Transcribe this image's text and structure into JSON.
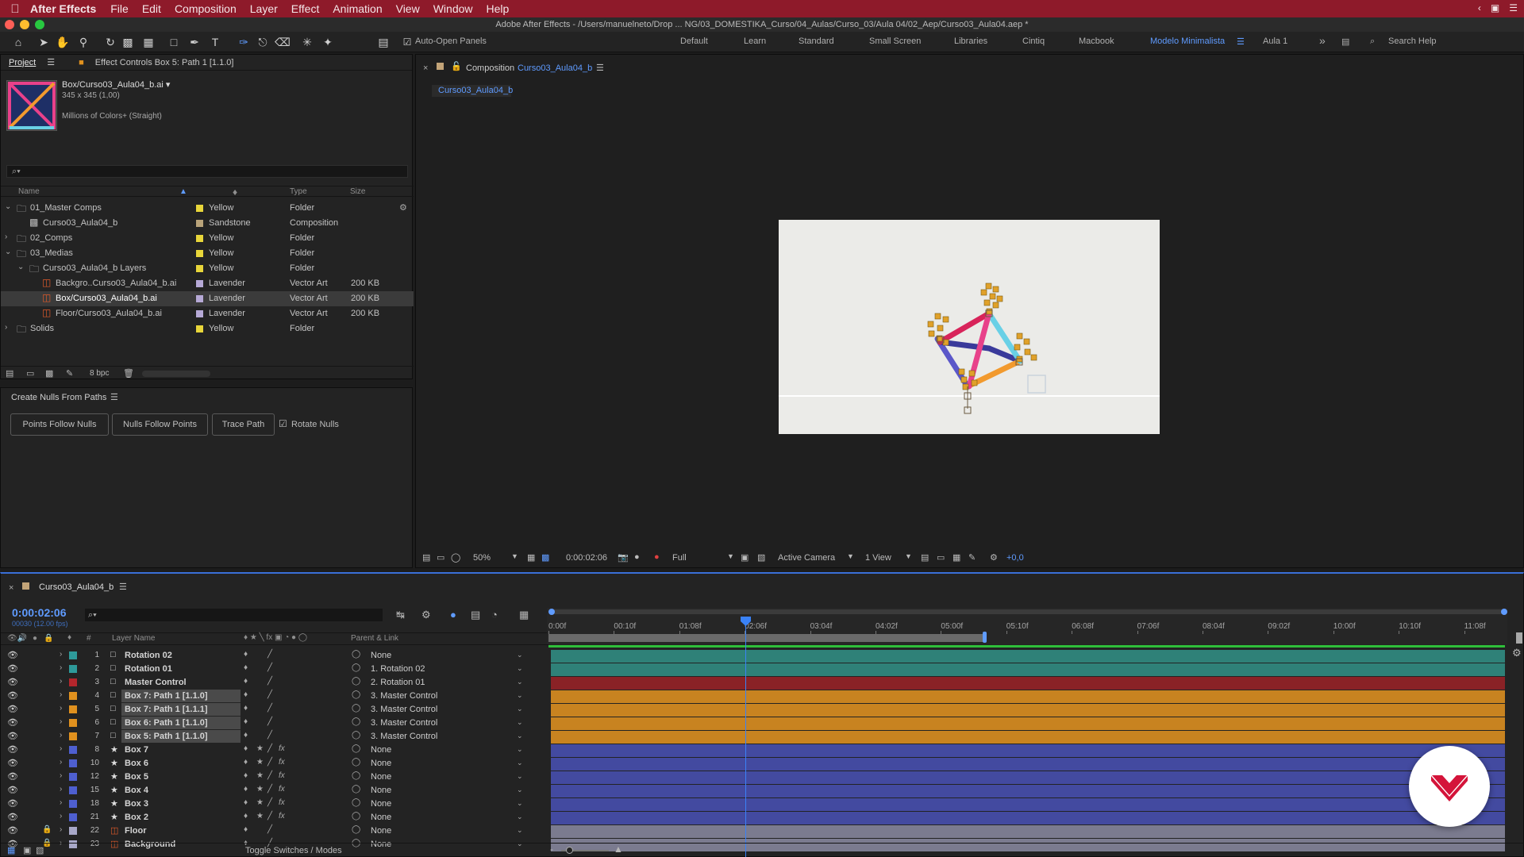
{
  "menubar": {
    "app_name": "After Effects",
    "items": [
      "File",
      "Edit",
      "Composition",
      "Layer",
      "Effect",
      "Animation",
      "View",
      "Window",
      "Help"
    ]
  },
  "window": {
    "title": "Adobe After Effects - /Users/manuelneto/Drop ... NG/03_DOMESTIKA_Curso/04_Aulas/Curso_03/Aula 04/02_Aep/Curso03_Aula04.aep *"
  },
  "toolbar": {
    "auto_open_label": "Auto-Open Panels",
    "workspaces": [
      "Default",
      "Learn",
      "Standard",
      "Small Screen",
      "Libraries",
      "Cintiq",
      "Macbook",
      "Modelo Minimalista",
      "Aula 1"
    ],
    "active_workspace": "Modelo Minimalista",
    "search_label": "Search Help"
  },
  "project": {
    "tab_project": "Project",
    "tab_effect": "Effect Controls Box 5: Path 1 [1.1.0]",
    "item_name": "Box/Curso03_Aula04_b.ai ▾",
    "item_dims": "345 x 345 (1,00)",
    "item_colors": "Millions of Colors+ (Straight)",
    "search_placeholder": "⌕▾",
    "columns": {
      "name": "Name",
      "type": "Type",
      "size": "Size"
    },
    "rows": [
      {
        "name": "01_Master Comps",
        "label": "Yellow",
        "type": "Folder",
        "size": ""
      },
      {
        "name": "Curso03_Aula04_b",
        "label": "Sandstone",
        "type": "Composition",
        "size": ""
      },
      {
        "name": "02_Comps",
        "label": "Yellow",
        "type": "Folder",
        "size": ""
      },
      {
        "name": "03_Medias",
        "label": "Yellow",
        "type": "Folder",
        "size": ""
      },
      {
        "name": "Curso03_Aula04_b Layers",
        "label": "Yellow",
        "type": "Folder",
        "size": ""
      },
      {
        "name": "Backgro..Curso03_Aula04_b.ai",
        "label": "Lavender",
        "type": "Vector Art",
        "size": "200 KB"
      },
      {
        "name": "Box/Curso03_Aula04_b.ai",
        "label": "Lavender",
        "type": "Vector Art",
        "size": "200 KB"
      },
      {
        "name": "Floor/Curso03_Aula04_b.ai",
        "label": "Lavender",
        "type": "Vector Art",
        "size": "200 KB"
      },
      {
        "name": "Solids",
        "label": "Yellow",
        "type": "Folder",
        "size": ""
      }
    ],
    "bpc": "8 bpc"
  },
  "nulls_panel": {
    "title": "Create Nulls From Paths",
    "btn_points": "Points Follow Nulls",
    "btn_nulls": "Nulls Follow Points",
    "btn_trace": "Trace Path",
    "rotate_label": "Rotate Nulls"
  },
  "composition": {
    "tab_label": "Composition",
    "tab_comp": "Curso03_Aula04_b",
    "breadcrumb": "Curso03_Aula04_b",
    "zoom": "50%",
    "timecode": "0:00:02:06",
    "resolution": "Full",
    "camera": "Active Camera",
    "views": "1 View",
    "offset": "+0,0"
  },
  "timeline": {
    "tab": "Curso03_Aula04_b",
    "timecode": "0:00:02:06",
    "frame_info": "00030 (12.00 fps)",
    "col_layer_name": "Layer Name",
    "col_parent": "Parent & Link",
    "toggle_label": "Toggle Switches / Modes",
    "ruler": [
      "0:00f",
      "00:10f",
      "01:08f",
      "02:06f",
      "03:04f",
      "04:02f",
      "05:00f",
      "05:10f",
      "06:08f",
      "07:06f",
      "08:04f",
      "09:02f",
      "10:00f",
      "10:10f",
      "11:08f"
    ],
    "layers": [
      {
        "num": "1",
        "name": "Rotation 02",
        "parent": "None",
        "color": "#2e9a9a",
        "bar": "#2f8178"
      },
      {
        "num": "2",
        "name": "Rotation 01",
        "parent": "1. Rotation 02",
        "color": "#2e9a9a",
        "bar": "#2f8178"
      },
      {
        "num": "3",
        "name": "Master Control",
        "parent": "2. Rotation 01",
        "color": "#b3262c",
        "bar": "#8a2226"
      },
      {
        "num": "4",
        "name": "Box 7: Path 1 [1.1.0]",
        "parent": "3. Master Control",
        "color": "#e0911e",
        "bar": "#c88320"
      },
      {
        "num": "5",
        "name": "Box 7: Path 1 [1.1.1]",
        "parent": "3. Master Control",
        "color": "#e0911e",
        "bar": "#c88320"
      },
      {
        "num": "6",
        "name": "Box 6: Path 1 [1.1.0]",
        "parent": "3. Master Control",
        "color": "#e0911e",
        "bar": "#c88320"
      },
      {
        "num": "7",
        "name": "Box 5: Path 1 [1.1.0]",
        "parent": "3. Master Control",
        "color": "#e0911e",
        "bar": "#c88320"
      },
      {
        "num": "8",
        "name": "Box 7",
        "parent": "None",
        "color": "#4e5fd0",
        "bar": "#434aa0"
      },
      {
        "num": "10",
        "name": "Box 6",
        "parent": "None",
        "color": "#4e5fd0",
        "bar": "#434aa0"
      },
      {
        "num": "12",
        "name": "Box 5",
        "parent": "None",
        "color": "#4e5fd0",
        "bar": "#434aa0"
      },
      {
        "num": "15",
        "name": "Box 4",
        "parent": "None",
        "color": "#4e5fd0",
        "bar": "#434aa0"
      },
      {
        "num": "18",
        "name": "Box 3",
        "parent": "None",
        "color": "#4e5fd0",
        "bar": "#434aa0"
      },
      {
        "num": "21",
        "name": "Box 2",
        "parent": "None",
        "color": "#4e5fd0",
        "bar": "#434aa0"
      },
      {
        "num": "22",
        "name": "Floor",
        "parent": "None",
        "color": "#a8a8c8",
        "bar": "#7b7b8f"
      },
      {
        "num": "23",
        "name": "Background",
        "parent": "None",
        "color": "#a8a8c8",
        "bar": "#7b7b8f"
      }
    ]
  }
}
